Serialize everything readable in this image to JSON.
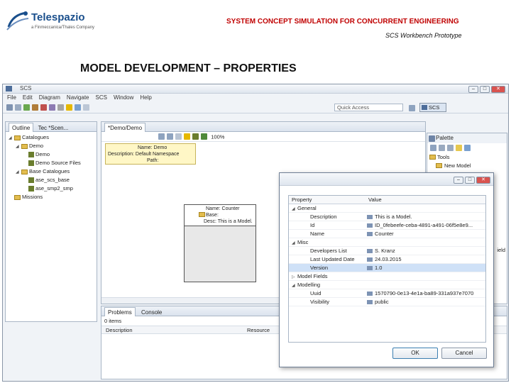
{
  "slide": {
    "logo_name": "Telespazio",
    "logo_tagline": "a Finmeccanica/Thales Company",
    "header_title": "SYSTEM CONCEPT SIMULATION FOR CONCURRENT ENGINEERING",
    "header_subtitle": "SCS Workbench Prototype",
    "title": "MODEL DEVELOPMENT – PROPERTIES"
  },
  "window": {
    "title": "SCS",
    "menu": [
      "File",
      "Edit",
      "Diagram",
      "Navigate",
      "SCS",
      "Window",
      "Help"
    ],
    "quick_access": "Quick Access",
    "perspective": "SCS",
    "zoom": "100%"
  },
  "outline": {
    "tabs": [
      "Outline",
      "Tec *Scen..."
    ],
    "tree": [
      {
        "label": "Catalogues",
        "depth": 0,
        "arrow": "◢"
      },
      {
        "label": "Demo",
        "depth": 1,
        "arrow": "◢"
      },
      {
        "label": "Demo",
        "depth": 2,
        "arrow": ""
      },
      {
        "label": "Demo Source Files",
        "depth": 2,
        "arrow": ""
      },
      {
        "label": "Base Catalogues",
        "depth": 1,
        "arrow": "◢"
      },
      {
        "label": "ase_scs_base",
        "depth": 2,
        "arrow": ""
      },
      {
        "label": "ase_smp2_smp",
        "depth": 2,
        "arrow": ""
      },
      {
        "label": "Missions",
        "depth": 0,
        "arrow": ""
      }
    ]
  },
  "editor": {
    "tab": "*Demo/Demo",
    "note_name": "Name: Demo",
    "note_desc": "Description: Default Namespace",
    "note_path": "Path:",
    "model_name": "Name: Counter",
    "model_base": "Base:",
    "model_desc": "Desc: This is a Model."
  },
  "palette": {
    "title": "Palette",
    "group": "Tools",
    "item": "New Model",
    "cut_text": "ield"
  },
  "bottom": {
    "tabs": [
      "Problems",
      "Console"
    ],
    "count": "0 items",
    "col_description": "Description",
    "col_resource": "Resource"
  },
  "properties_dialog": {
    "col_property": "Property",
    "col_value": "Value",
    "rows": [
      {
        "kind": "group",
        "arrow": "◢",
        "label": "General",
        "value": ""
      },
      {
        "kind": "item",
        "label": "Description",
        "value": "This is a Model."
      },
      {
        "kind": "item",
        "label": "Id",
        "value": "ID_0febeefe-ceba-4891-a491-06f5e8e9..."
      },
      {
        "kind": "item",
        "label": "Name",
        "value": "Counter"
      },
      {
        "kind": "group",
        "arrow": "◢",
        "label": "Misc",
        "value": ""
      },
      {
        "kind": "item",
        "label": "Developers List",
        "value": "S. Kranz"
      },
      {
        "kind": "item",
        "label": "Last Updated Date",
        "value": "24.03.2015"
      },
      {
        "kind": "item",
        "label": "Version",
        "value": "1.0",
        "selected": true
      },
      {
        "kind": "group",
        "arrow": "▷",
        "label": "Model Fields",
        "value": ""
      },
      {
        "kind": "group",
        "arrow": "◢",
        "label": "Modelling",
        "value": ""
      },
      {
        "kind": "item",
        "label": "Uuid",
        "value": "1570790-0e13-4e1a-ba89-331a937e7070"
      },
      {
        "kind": "item",
        "label": "Visibility",
        "value": "public"
      }
    ],
    "ok": "OK",
    "cancel": "Cancel"
  },
  "colors": {
    "header_red": "#c00000",
    "selection": "#cfe1f7",
    "note_yellow": "#fff7c6"
  }
}
